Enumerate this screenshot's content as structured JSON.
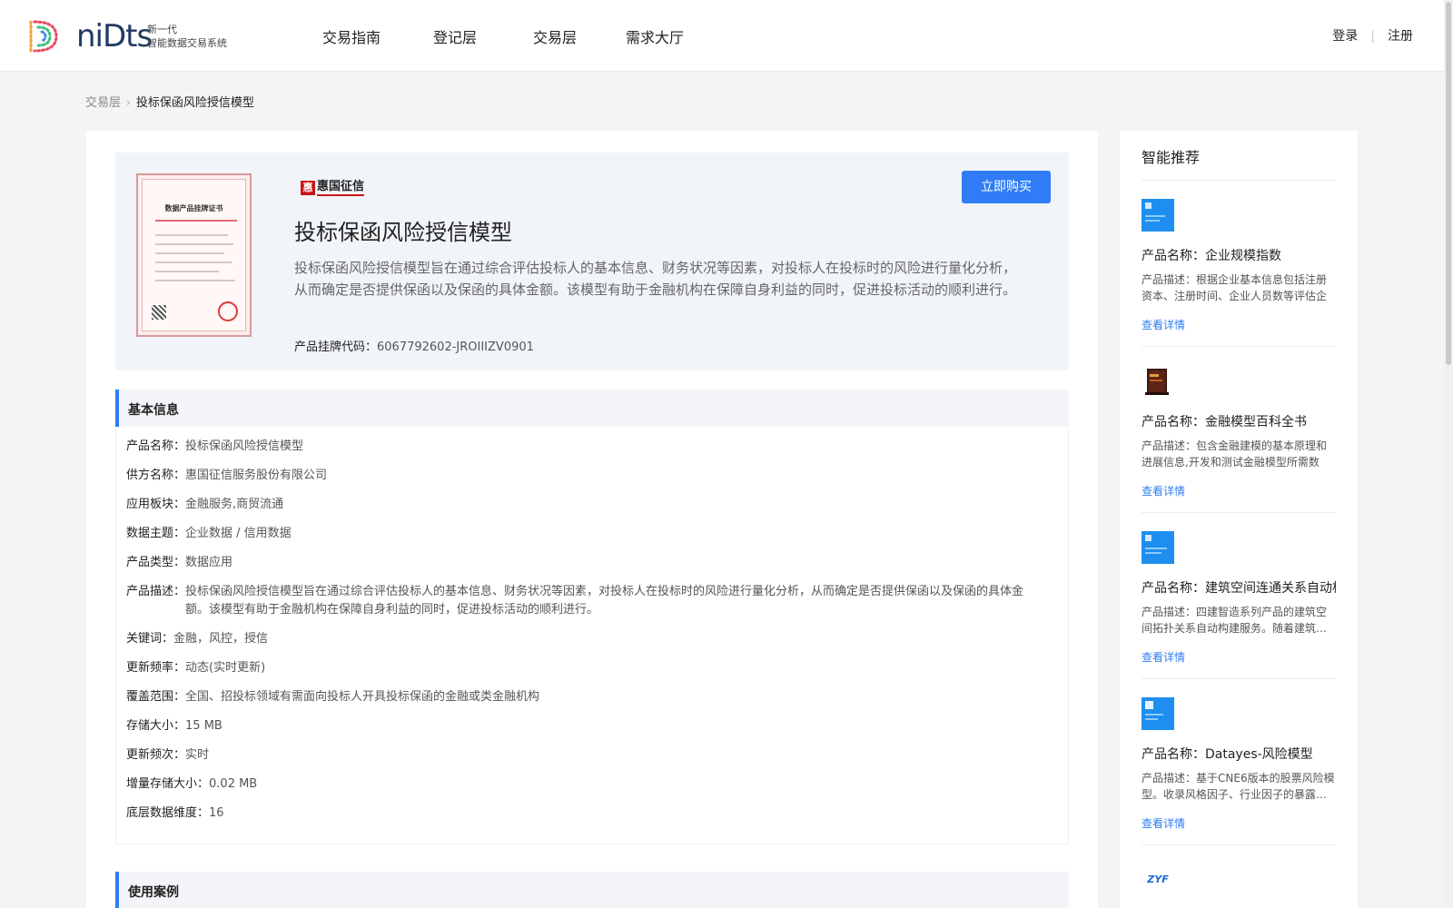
{
  "header": {
    "logo_word": "niDts",
    "logo_sub1": "新一代",
    "logo_sub2": "智能数据交易系统",
    "nav": [
      "交易指南",
      "登记层",
      "交易层",
      "需求大厅"
    ],
    "login": "登录",
    "register": "注册"
  },
  "breadcrumb": {
    "parent": "交易层",
    "current": "投标保函风险授信模型"
  },
  "hero": {
    "brand_mark": "惠",
    "brand_name": "惠国征信",
    "buy_label": "立即购买",
    "title": "投标保函风险授信模型",
    "description": "投标保函风险授信模型旨在通过综合评估投标人的基本信息、财务状况等因素，对投标人在投标时的风险进行量化分析，从而确定是否提供保函以及保函的具体金额。该模型有助于金融机构在保障自身利益的同时，促进投标活动的顺利进行。",
    "code_label": "产品挂牌代码：",
    "code_value": "6067792602-JROIIIZV0901",
    "cert_title": "数据产品挂牌证书"
  },
  "basic_info": {
    "heading": "基本信息",
    "rows": [
      {
        "label": "产品名称：",
        "value": "投标保函风险授信模型"
      },
      {
        "label": "供方名称：",
        "value": "惠国征信服务股份有限公司"
      },
      {
        "label": "应用板块：",
        "value": "金融服务,商贸流通"
      },
      {
        "label": "数据主题：",
        "value": "企业数据 / 信用数据"
      },
      {
        "label": "产品类型：",
        "value": "数据应用"
      },
      {
        "label": "产品描述：",
        "value": "投标保函风险授信模型旨在通过综合评估投标人的基本信息、财务状况等因素，对投标人在投标时的风险进行量化分析，从而确定是否提供保函以及保函的具体金额。该模型有助于金融机构在保障自身利益的同时，促进投标活动的顺利进行。"
      },
      {
        "label": "关键词：",
        "value": "金融，风控，授信"
      },
      {
        "label": "更新频率：",
        "value": "动态(实时更新)"
      },
      {
        "label": "覆盖范围：",
        "value": "全国、招投标领域有需面向投标人开具投标保函的金融或类金融机构"
      },
      {
        "label": "存储大小：",
        "value": "15 MB"
      },
      {
        "label": "更新频次：",
        "value": "实时"
      },
      {
        "label": "增量存储大小：",
        "value": "0.02 MB"
      },
      {
        "label": "底层数据维度：",
        "value": "16"
      }
    ]
  },
  "use_cases": {
    "heading": "使用案例"
  },
  "sidebar": {
    "title": "智能推荐",
    "name_prefix": "产品名称：",
    "link_label": "查看详情",
    "items": [
      {
        "name": "企业规模指数",
        "desc": "产品描述：根据企业基本信息包括注册资本、注册时间、企业人员数等评估企业规模…",
        "thumb": "blue"
      },
      {
        "name": "金融模型百科全书",
        "desc": "产品描述：包含金融建模的基本原理和进展信息,开发和测试金融模型所需数据…",
        "thumb": "book"
      },
      {
        "name": "建筑空间连通关系自动构建服务",
        "desc": "产品描述：四建智造系列产品的建筑空间拓扑关系自动构建服务。随着建筑…",
        "thumb": "blue"
      },
      {
        "name": "Datayes-风险模型",
        "desc": "产品描述：基于CNE6版本的股票风险模型。收录风格因子、行业因子的暴露…",
        "thumb": "blue"
      },
      {
        "name": "",
        "desc": "",
        "thumb": "zyf",
        "thumb_text": "ZYF"
      }
    ]
  }
}
